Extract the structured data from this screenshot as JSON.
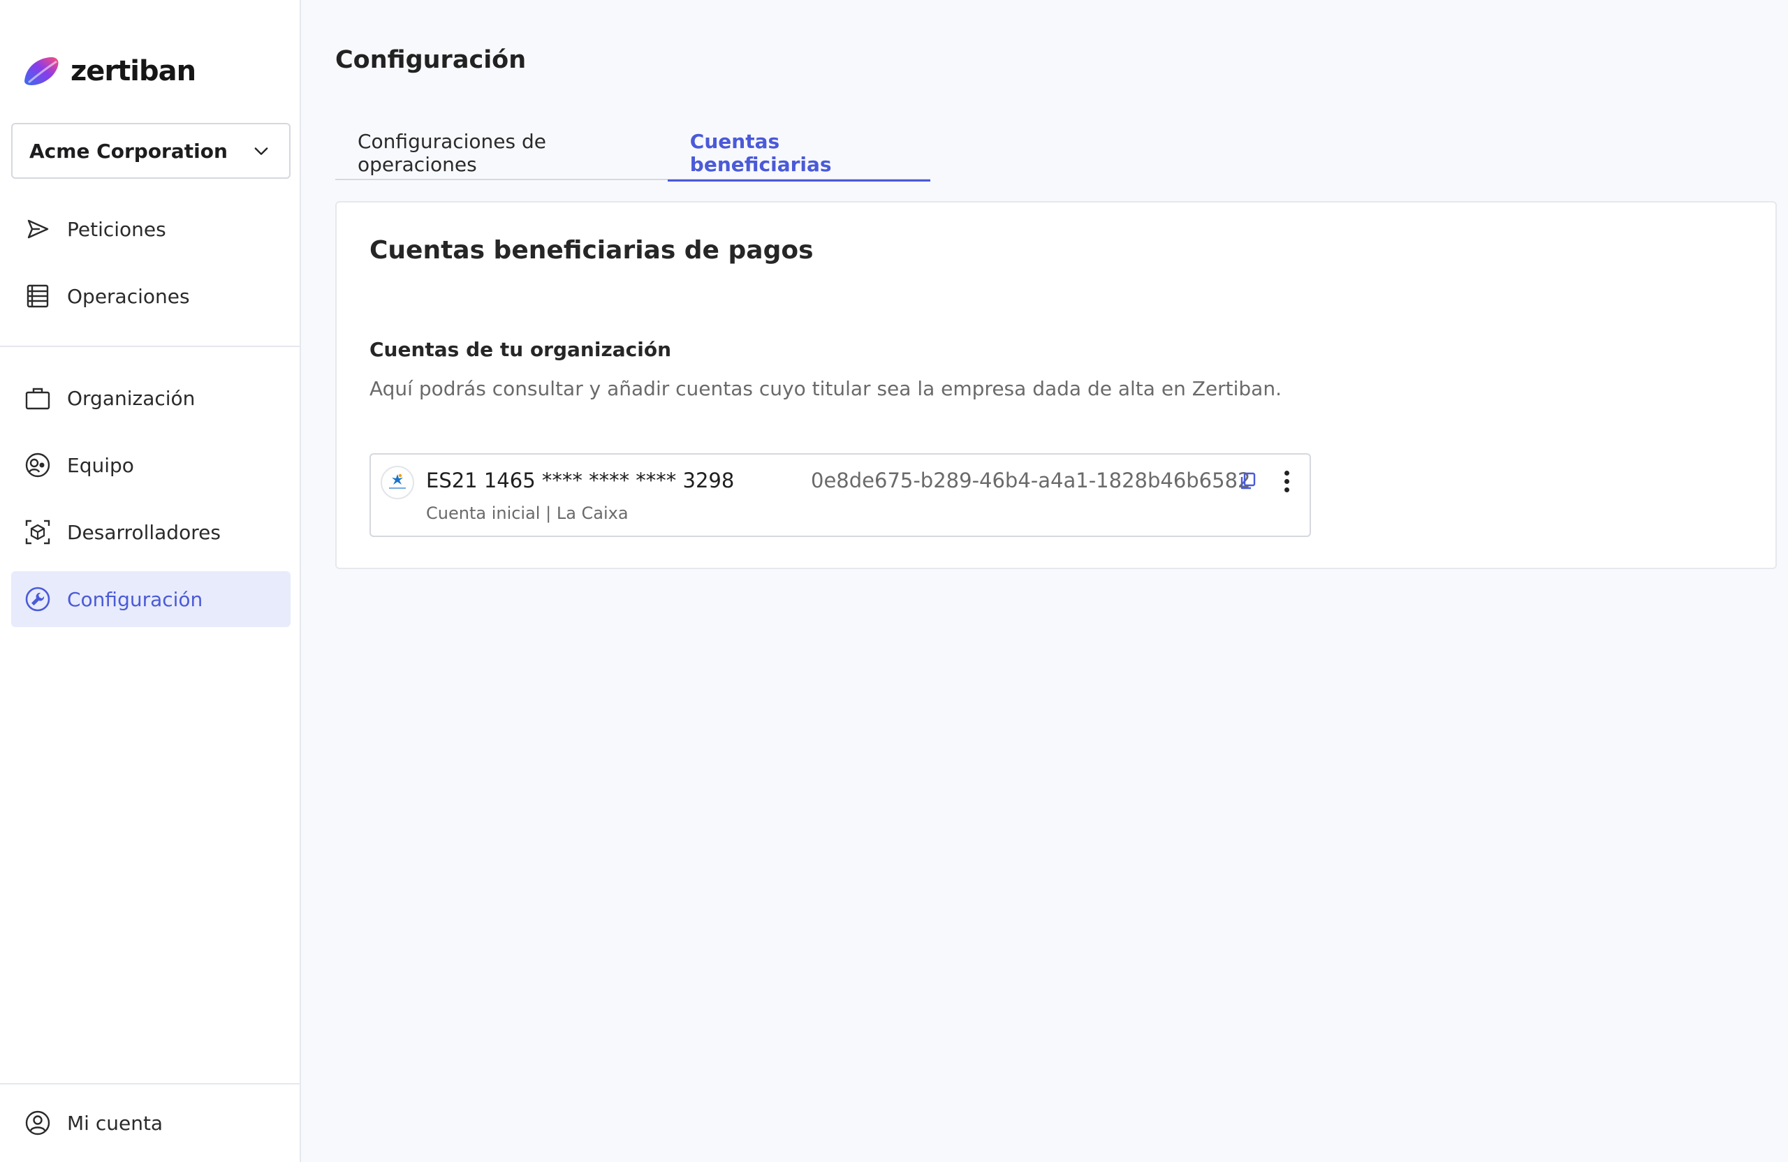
{
  "brand": {
    "name": "zertiban"
  },
  "org_selector": {
    "value": "Acme Corporation"
  },
  "sidebar": {
    "items": [
      {
        "label": "Peticiones",
        "icon": "send-icon"
      },
      {
        "label": "Operaciones",
        "icon": "list-icon"
      },
      {
        "label": "Organización",
        "icon": "briefcase-icon"
      },
      {
        "label": "Equipo",
        "icon": "team-icon"
      },
      {
        "label": "Desarrolladores",
        "icon": "cube-scan-icon"
      },
      {
        "label": "Configuración",
        "icon": "wrench-icon",
        "active": true
      }
    ],
    "footer": {
      "label": "Mi cuenta",
      "icon": "user-circle-icon"
    }
  },
  "main": {
    "title": "Configuración",
    "tabs": [
      {
        "label": "Configuraciones de operaciones",
        "active": false
      },
      {
        "label": "Cuentas beneficiarias",
        "active": true
      }
    ],
    "card": {
      "title": "Cuentas beneficiarias de pagos",
      "section_title": "Cuentas de tu organización",
      "section_description": "Aquí podrás consultar y añadir cuentas cuyo titular sea la empresa dada de alta en Zertiban.",
      "accounts": [
        {
          "iban": "ES21 1465 **** **** **** 3298",
          "subtitle": "Cuenta inicial | La Caixa",
          "id": "0e8de675-b289-46b4-a4a1-1828b46b6582",
          "bank_icon": "caixabank-logo"
        }
      ]
    }
  },
  "colors": {
    "accent": "#4a5ad8",
    "active_nav_bg": "#e8ebfb",
    "page_bg": "#f8f9fd"
  }
}
